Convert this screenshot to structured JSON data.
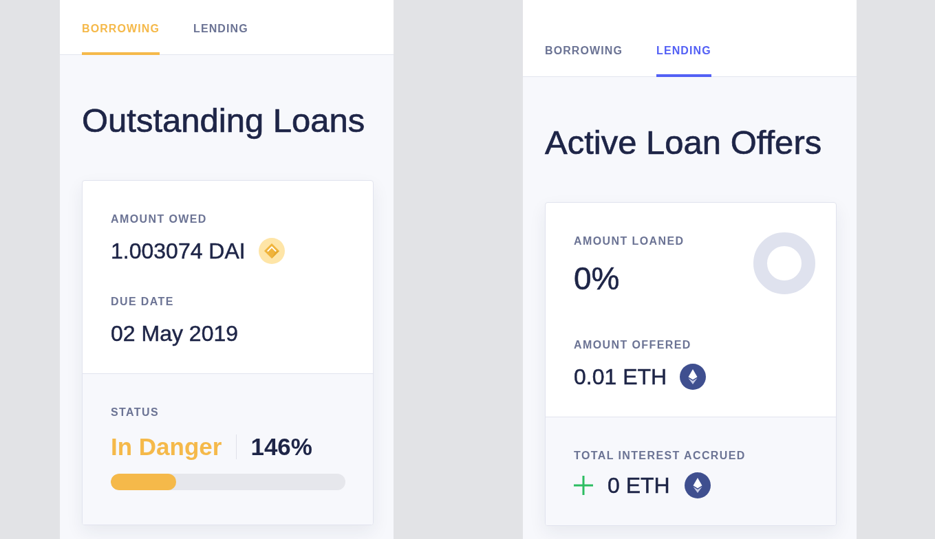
{
  "panels": [
    {
      "tabs": [
        {
          "label": "BORROWING",
          "selected": true
        },
        {
          "label": "LENDING",
          "selected": false
        }
      ],
      "heading": "Outstanding Loans",
      "card": {
        "top": [
          {
            "kind": "dai",
            "label": "AMOUNT OWED",
            "value": "1.003074 DAI"
          },
          {
            "kind": "date",
            "label": "DUE DATE",
            "value": "02 May 2019"
          }
        ],
        "bottom": {
          "kind": "status",
          "label": "STATUS",
          "value": "In Danger",
          "ratio": "146%",
          "level": 0.28
        }
      }
    },
    {
      "tabs": [
        {
          "label": "BORROWING",
          "selected": false
        },
        {
          "label": "LENDING",
          "selected": true
        }
      ],
      "heading": "Active Loan Offers",
      "card": {
        "top": [
          {
            "kind": "gauge",
            "label": "AMOUNT LOANED",
            "value": "0%"
          },
          {
            "kind": "eth",
            "label": "AMOUNT OFFERED",
            "value": "0.01 ETH"
          }
        ],
        "bottom": {
          "kind": "interest",
          "label": "TOTAL INTEREST ACCRUED",
          "value": "0 ETH"
        }
      }
    }
  ]
}
